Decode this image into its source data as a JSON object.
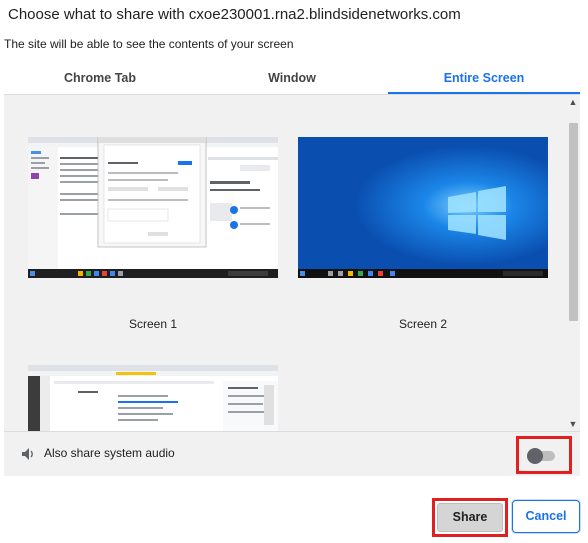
{
  "dialog": {
    "title": "Choose what to share with cxoe230001.rna2.blindsidenetworks.com",
    "subtitle": "The site will be able to see the contents of your screen"
  },
  "tabs": [
    {
      "label": "Chrome Tab",
      "active": false
    },
    {
      "label": "Window",
      "active": false
    },
    {
      "label": "Entire Screen",
      "active": true
    }
  ],
  "screens": [
    {
      "label": "Screen 1"
    },
    {
      "label": "Screen 2"
    }
  ],
  "audio": {
    "label": "Also share system audio",
    "enabled": false
  },
  "buttons": {
    "share": "Share",
    "cancel": "Cancel"
  },
  "colors": {
    "accent": "#1a73e8",
    "highlight": "#e0201f",
    "desktop_blue": "#0a5cc7"
  }
}
